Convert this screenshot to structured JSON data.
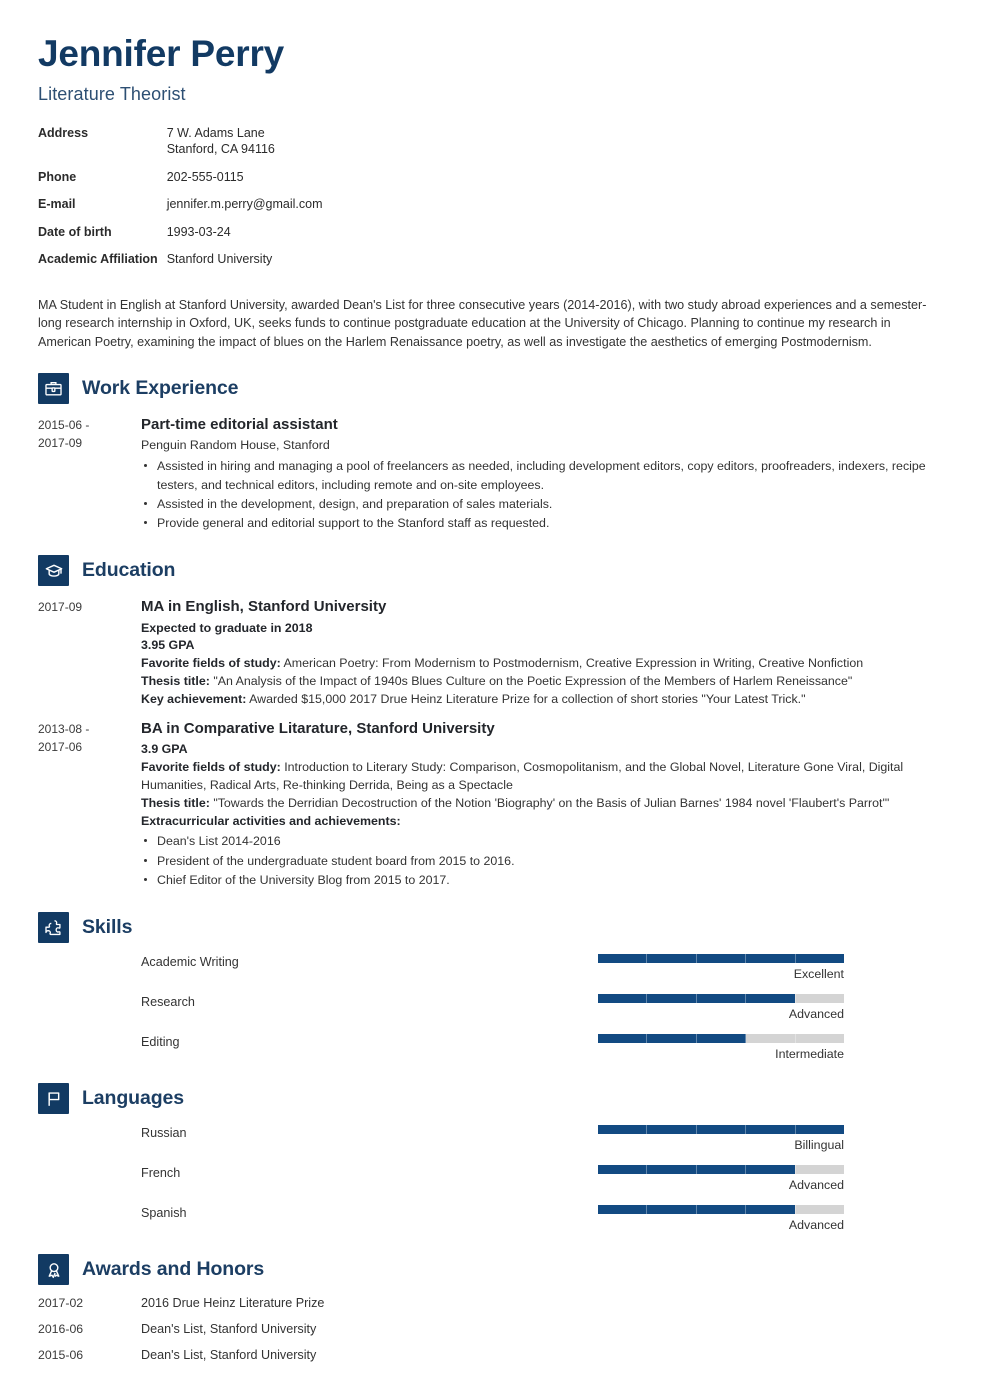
{
  "header": {
    "name": "Jennifer Perry",
    "job_title": "Literature Theorist",
    "contacts": [
      {
        "label": "Address",
        "value": "7 W. Adams Lane",
        "value2": "Stanford, CA 94116"
      },
      {
        "label": "Phone",
        "value": "202-555-0115"
      },
      {
        "label": "E-mail",
        "value": "jennifer.m.perry@gmail.com"
      },
      {
        "label": "Date of birth",
        "value": "1993-03-24"
      },
      {
        "label": "Academic Affiliation",
        "value": "Stanford University"
      }
    ]
  },
  "summary": "MA Student in English at Stanford University, awarded Dean's List for three consecutive years (2014-2016), with two study abroad experiences and a semester-long research internship in Oxford, UK, seeks funds to continue postgraduate education at the University of Chicago. Planning to continue my research in American Poetry, examining the impact of blues on the Harlem Renaissance poetry, as well as investigate the aesthetics of emerging Postmodernism.",
  "sections": {
    "work": {
      "title": "Work Experience",
      "icon": "briefcase-icon",
      "entries": [
        {
          "date_from": "2015-06 -",
          "date_to": "2017-09",
          "title": "Part-time editorial assistant",
          "subtitle": "Penguin Random House, Stanford",
          "bullets": [
            "Assisted in hiring and managing a pool of freelancers as needed, including development editors, copy editors, proofreaders, indexers, recipe testers, and technical editors, including remote and on-site employees.",
            "Assisted in the development, design, and preparation of sales materials.",
            "Provide general and editorial support to the Stanford staff as requested."
          ]
        }
      ]
    },
    "education": {
      "title": "Education",
      "icon": "graduation-cap-icon",
      "entries": [
        {
          "date_from": "2017-09",
          "date_to": "",
          "title": "MA in English, Stanford University",
          "bold_lines": [
            "Expected to graduate in 2018",
            "3.95 GPA"
          ],
          "labeled_lines": [
            {
              "label": "Favorite fields of study:",
              "text": "American Poetry: From Modernism to Postmodernism, Creative Expression in Writing, Creative Nonfiction"
            },
            {
              "label": "Thesis title:",
              "text": "\"An Analysis of the Impact of 1940s Blues Culture on the Poetic Expression of the Members of Harlem Reneissance\""
            },
            {
              "label": "Key achievement:",
              "text": "Awarded $15,000 2017 Drue Heinz Literature Prize for a collection of short stories \"Your Latest Trick.\""
            }
          ],
          "bullets_heading": "",
          "bullets": []
        },
        {
          "date_from": "2013-08 -",
          "date_to": "2017-06",
          "title": "BA in Comparative Litarature, Stanford University",
          "bold_lines": [
            "3.9 GPA"
          ],
          "labeled_lines": [
            {
              "label": "Favorite fields of study:",
              "text": "Introduction to Literary Study: Comparison, Cosmopolitanism, and the Global Novel, Literature Gone Viral, Digital Humanities, Radical Arts, Re-thinking Derrida, Being as a Spectacle"
            },
            {
              "label": "Thesis title:",
              "text": "\"Towards the Derridian Decostruction of the Notion 'Biography' on the Basis of Julian Barnes' 1984 novel 'Flaubert's Parrot'\""
            }
          ],
          "bullets_heading": "Extracurricular activities and achievements:",
          "bullets": [
            "Dean's List 2014-2016",
            "President of the undergraduate student board from 2015 to 2016.",
            "Chief Editor of the University Blog from 2015 to 2017."
          ]
        }
      ]
    },
    "skills": {
      "title": "Skills",
      "icon": "puzzle-piece-icon",
      "items": [
        {
          "label": "Academic Writing",
          "level": "Excellent",
          "percent": 100
        },
        {
          "label": "Research",
          "level": "Advanced",
          "percent": 80
        },
        {
          "label": "Editing",
          "level": "Intermediate",
          "percent": 60
        }
      ]
    },
    "languages": {
      "title": "Languages",
      "icon": "flag-icon",
      "items": [
        {
          "label": "Russian",
          "level": "Billingual",
          "percent": 100
        },
        {
          "label": "French",
          "level": "Advanced",
          "percent": 80
        },
        {
          "label": "Spanish",
          "level": "Advanced",
          "percent": 80
        }
      ]
    },
    "awards": {
      "title": "Awards and Honors",
      "icon": "award-ribbon-icon",
      "items": [
        {
          "date": "2017-02",
          "text": "2016 Drue Heinz Literature Prize"
        },
        {
          "date": "2016-06",
          "text": "Dean's List, Stanford University"
        },
        {
          "date": "2015-06",
          "text": "Dean's List, Stanford University"
        }
      ]
    }
  },
  "colors": {
    "navy": "#123a63",
    "heading": "#1c3e63",
    "bar_fill": "#124a82",
    "bar_track": "#d4d4d4"
  }
}
